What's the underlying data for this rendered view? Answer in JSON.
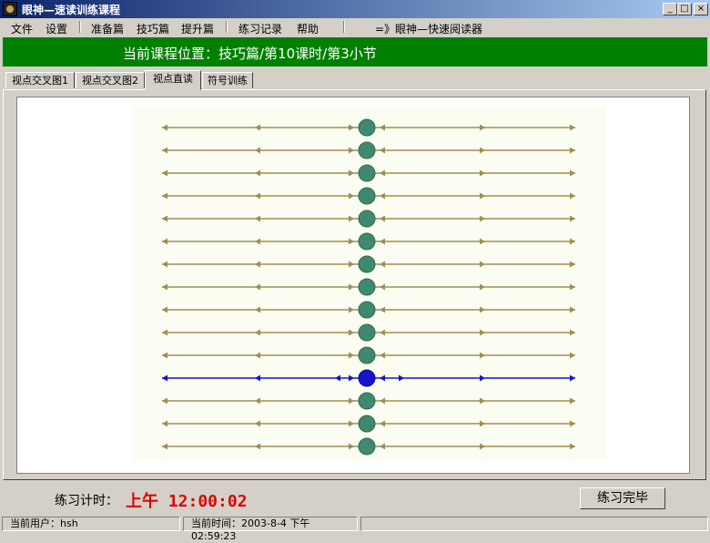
{
  "window": {
    "title": "眼神—速读训练课程",
    "buttons": {
      "minimize": "_",
      "maximize": "□",
      "close": "×"
    }
  },
  "menu": {
    "items": [
      "文件",
      "设置",
      "准备篇",
      "技巧篇",
      "提升篇",
      "练习记录",
      "帮助",
      "=》眼神—快速阅读器"
    ]
  },
  "course": {
    "position_text": "当前课程位置：技巧篇/第10课时/第3小节"
  },
  "tabs": [
    "视点交叉图1",
    "视点交叉图2",
    "视点直读",
    "符号训练"
  ],
  "active_tab": 2,
  "exercise": {
    "row_count": 15,
    "highlight_row_index": 11,
    "colors": {
      "line": "#9b9052",
      "dot": "#3f8a6e",
      "dot_stroke": "#2d6a52",
      "highlight": "#1414cc",
      "background": "#fcfdf2"
    }
  },
  "timer": {
    "label": "练习计时：",
    "value": "上午 12:00:02"
  },
  "done_button": "练习完毕",
  "status": {
    "user": "当前用户：hsh",
    "time": "当前时间：2003-8-4 下午 02:59:23"
  }
}
